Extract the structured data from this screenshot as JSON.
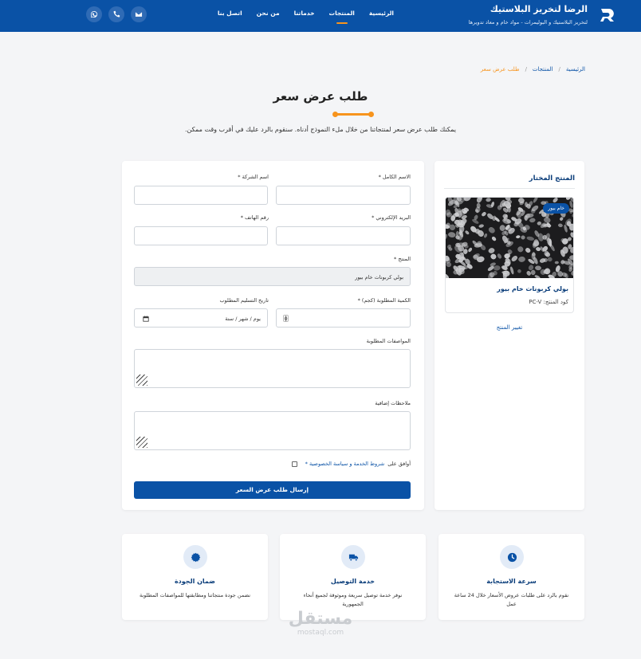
{
  "header": {
    "brand_title": "الرضا لتخريز البلاستيك",
    "brand_subtitle": "لتخريز البلاستيك و البوليمرات - مواد خام و معاد تدويرها",
    "nav": [
      "الرئيسية",
      "المنتجات",
      "خدماتنا",
      "من نحن",
      "اتصل بنا"
    ],
    "active_nav": "المنتجات",
    "social_icons": [
      "whatsapp-icon",
      "phone-icon",
      "mail-icon"
    ]
  },
  "breadcrumb": {
    "home": "الرئيسية",
    "products": "المنتجات",
    "current": "طلب عرض سعر"
  },
  "page": {
    "title": "طلب عرض سعر",
    "intro": "يمكنك طلب عرض سعر لمنتجاتنا من خلال ملء النموذج أدناه. سنقوم بالرد عليك في أقرب وقت ممكن."
  },
  "selected_product": {
    "title": "المنتج المختار",
    "badge": "خام بيور",
    "name": "بولي كربونات خام بيور",
    "code": "كود المنتج: PC-V",
    "change_link": "تغيير المنتج"
  },
  "form": {
    "full_name_label": "الاسم الكامل *",
    "company_label": "اسم الشركة *",
    "email_label": "البريد الإلكتروني *",
    "phone_label": "رقم الهاتف *",
    "product_label": "المنتج *",
    "product_value": "بولي كربونات خام بيور",
    "quantity_label": "الكمية المطلوبة (كجم) *",
    "delivery_date_label": "تاريخ التسليم المطلوب",
    "delivery_date_placeholder": "يوم / شهر / سنة",
    "specs_label": "المواصفات المطلوبة",
    "notes_label": "ملاحظات إضافية",
    "agree_prefix": "أوافق على",
    "agree_link": "شروط الخدمة و سياسة الخصوصية *",
    "submit": "إرسال طلب عرض السعر"
  },
  "features": [
    {
      "icon": "clock-icon",
      "title": "سرعة الاستجابة",
      "desc": "نقوم بالرد على طلبات عروض الأسعار خلال 24 ساعة عمل"
    },
    {
      "icon": "truck-icon",
      "title": "خدمة التوصيل",
      "desc": "نوفر خدمة توصيل سريعة وموثوقة لجميع أنحاء الجمهورية"
    },
    {
      "icon": "badge-icon",
      "title": "ضمان الجودة",
      "desc": "نضمن جودة منتجاتنا ومطابقتها للمواصفات المطلوبة"
    }
  ],
  "watermark": {
    "name": "مستقل",
    "domain": "mostaql.com"
  },
  "colors": {
    "primary": "#0a52a6",
    "accent": "#f7941d",
    "background": "#f4f5f7"
  }
}
